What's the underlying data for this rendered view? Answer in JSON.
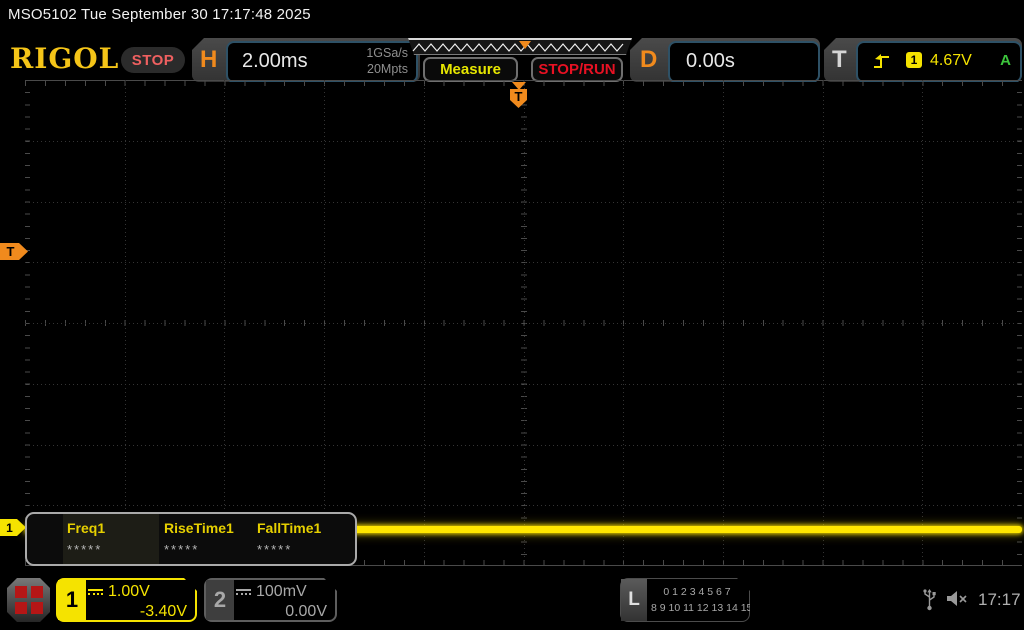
{
  "titlebar": {
    "text": "MSO5102  Tue September 30 17:17:48 2025"
  },
  "header": {
    "logo": "RIGOL",
    "acq_status": "STOP",
    "horizontal": {
      "label": "H",
      "timebase": "2.00ms",
      "sample_rate": "1GSa/s",
      "mem_depth": "20Mpts"
    },
    "measure_button": "Measure",
    "stoprun_button": "STOP/RUN",
    "delay": {
      "label": "D",
      "value": "0.00s"
    },
    "trigger": {
      "label": "T",
      "source_channel": "1",
      "level": "4.67V",
      "sweep_mode": "A"
    }
  },
  "graticule": {
    "trigger_position_indicator": "T",
    "trigger_level_indicator": "T",
    "channel1_indicator": "1"
  },
  "measure_popup": {
    "items": [
      {
        "label": "Freq1",
        "value": "*****"
      },
      {
        "label": "RiseTime1",
        "value": "*****"
      },
      {
        "label": "FallTime1",
        "value": "*****"
      }
    ]
  },
  "bottombar": {
    "ch1": {
      "number": "1",
      "scale": "1.00V",
      "offset": "-3.40V"
    },
    "ch2": {
      "number": "2",
      "scale": "100mV",
      "offset": "0.00V"
    },
    "logic": {
      "label": "L",
      "row1": "0 1 2 3  4 5 6 7",
      "row2": "8 9 10 11 12 13 14 15"
    },
    "clock": "17:17"
  },
  "colors": {
    "channel1_yellow": "#f5e300",
    "trigger_orange": "#f08a1d",
    "stop_red": "#e81123",
    "sweep_green": "#3cc43c",
    "logo_gold": "#f5c518"
  }
}
